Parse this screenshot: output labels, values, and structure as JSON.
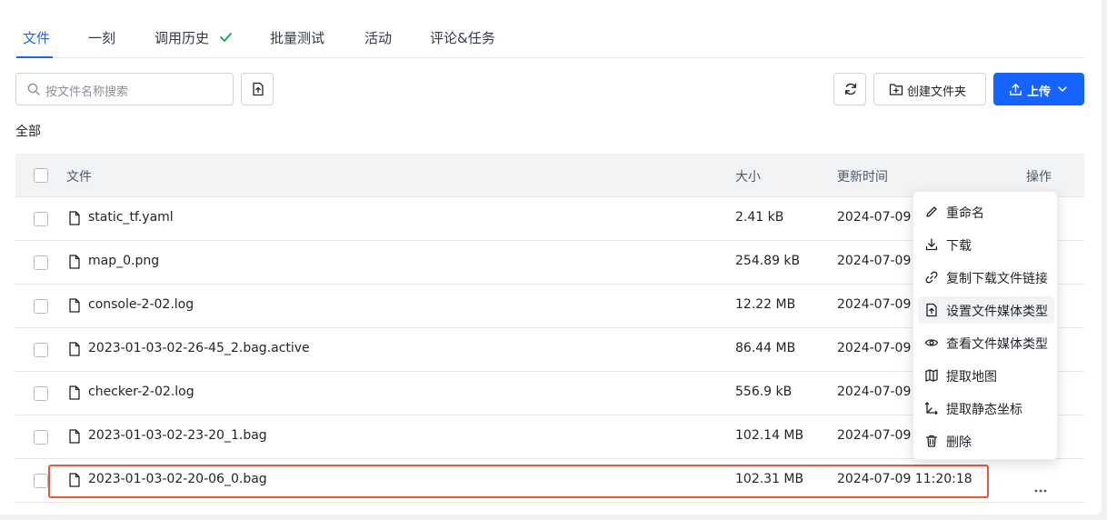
{
  "tabs": [
    {
      "label": "文件",
      "active": true
    },
    {
      "label": "一刻"
    },
    {
      "label": "调用历史",
      "status_icon": "check-icon"
    },
    {
      "label": "批量测试"
    },
    {
      "label": "活动"
    },
    {
      "label": "评论&任务"
    }
  ],
  "search": {
    "placeholder": "按文件名称搜索"
  },
  "toolbar": {
    "upload_file_icon": "file-upload-icon",
    "refresh_icon": "refresh-icon",
    "new_folder_label": "创建文件夹",
    "upload_label": "上传"
  },
  "breadcrumb": "全部",
  "table": {
    "headers": {
      "file": "文件",
      "size": "大小",
      "updated": "更新时间",
      "actions": "操作"
    },
    "rows": [
      {
        "name": "static_tf.yaml",
        "size": "2.41 kB",
        "time": "2024-07-09"
      },
      {
        "name": "map_0.png",
        "size": "254.89 kB",
        "time": "2024-07-09"
      },
      {
        "name": "console-2-02.log",
        "size": "12.22 MB",
        "time": "2024-07-09"
      },
      {
        "name": "2023-01-03-02-26-45_2.bag.active",
        "size": "86.44 MB",
        "time": "2024-07-09"
      },
      {
        "name": "checker-2-02.log",
        "size": "556.9 kB",
        "time": "2024-07-09"
      },
      {
        "name": "2023-01-03-02-23-20_1.bag",
        "size": "102.14 MB",
        "time": "2024-07-09"
      },
      {
        "name": "2023-01-03-02-20-06_0.bag",
        "size": "102.31 MB",
        "time": "2024-07-09 11:20:18",
        "selected": true
      }
    ]
  },
  "context_menu": {
    "items": [
      {
        "label": "重命名",
        "icon": "edit-icon"
      },
      {
        "label": "下载",
        "icon": "download-icon"
      },
      {
        "label": "复制下载文件链接",
        "icon": "link-icon"
      },
      {
        "label": "设置文件媒体类型",
        "icon": "file-upload-icon",
        "hover": true
      },
      {
        "label": "查看文件媒体类型",
        "icon": "eye-icon"
      },
      {
        "label": "提取地图",
        "icon": "map-icon"
      },
      {
        "label": "提取静态坐标",
        "icon": "axis-icon"
      },
      {
        "label": "删除",
        "icon": "trash-icon"
      }
    ]
  },
  "colors": {
    "accent": "#1664ff",
    "highlight": "#e8593a"
  }
}
